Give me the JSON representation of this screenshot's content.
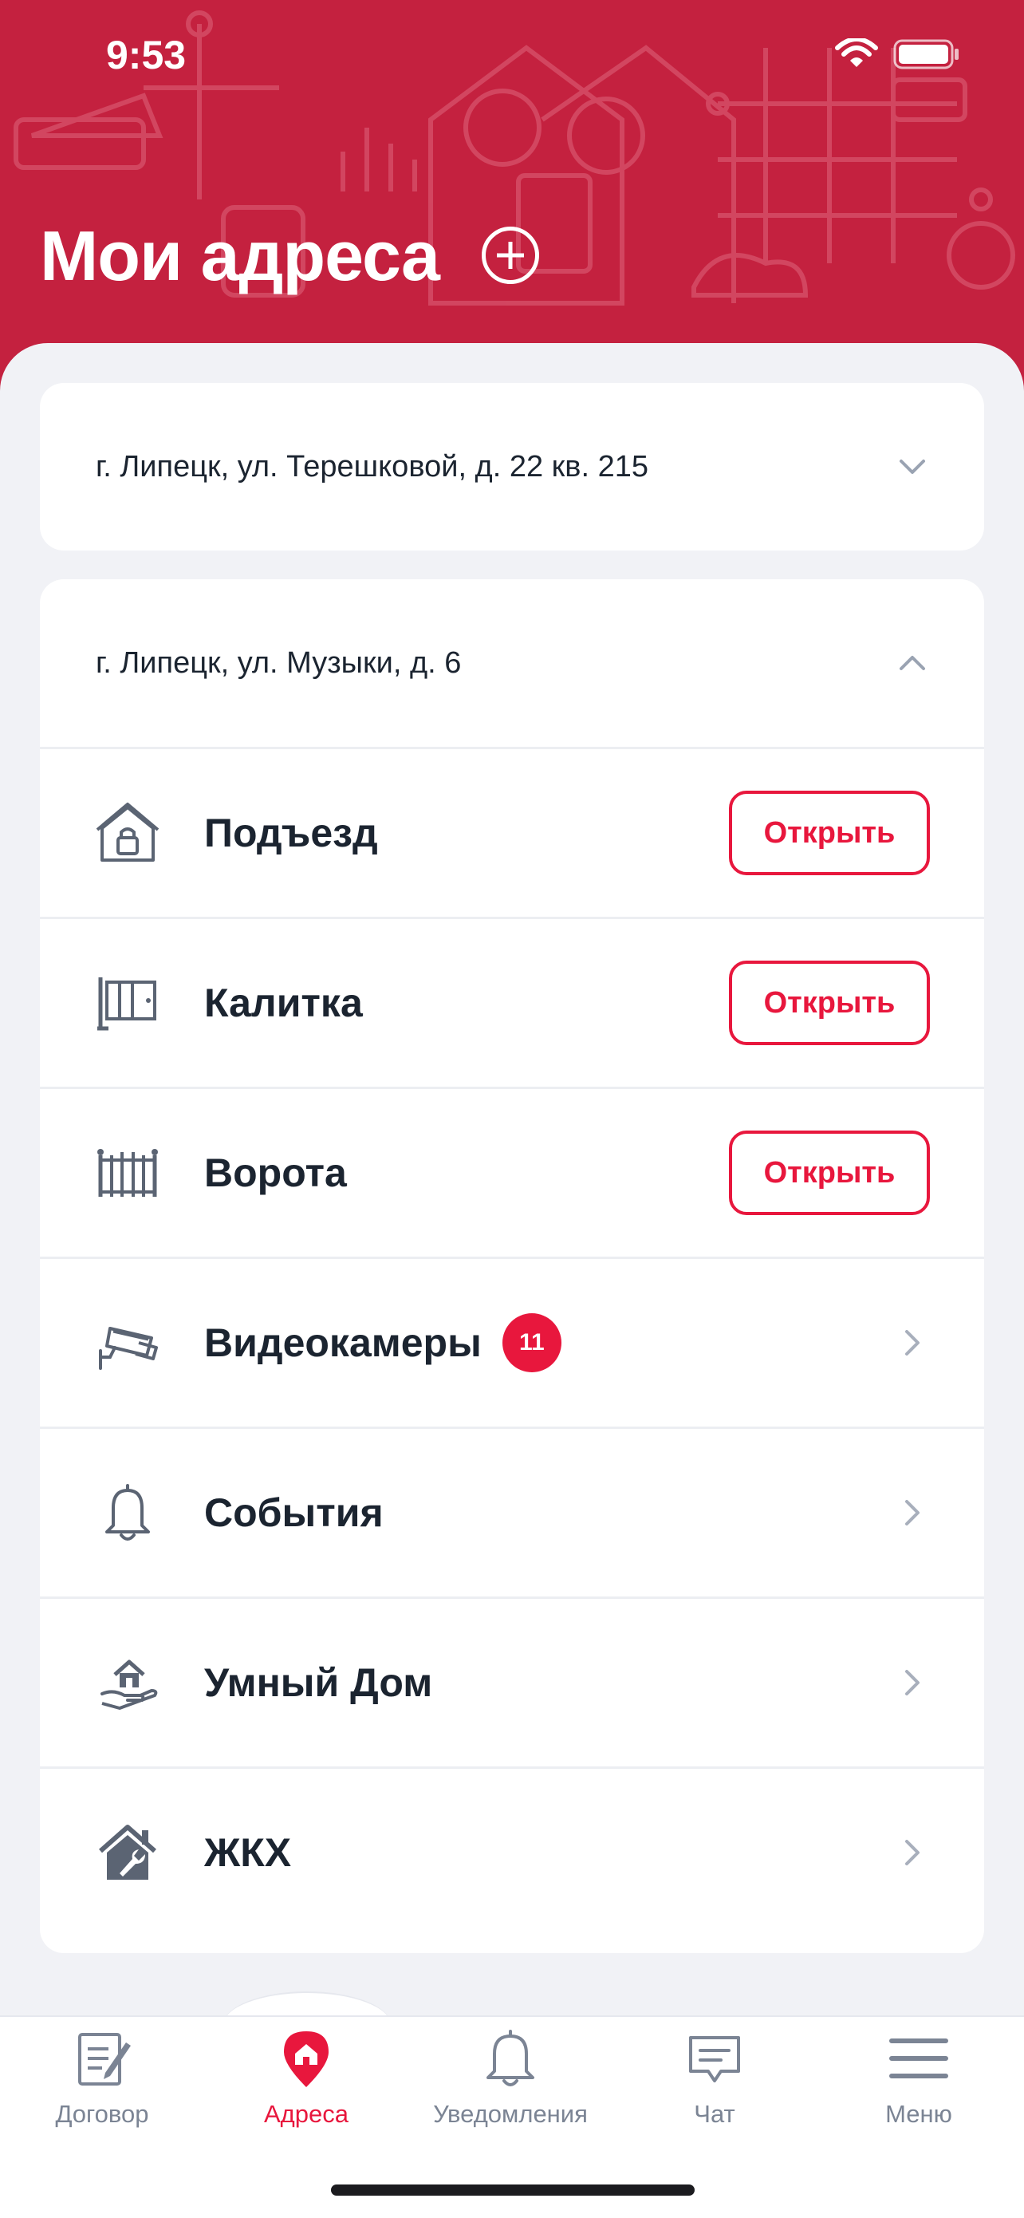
{
  "status_bar": {
    "time": "9:53"
  },
  "header": {
    "title": "Мои адреса",
    "bg_color": "#C4213F",
    "add_icon": "plus-circle-icon"
  },
  "addresses": [
    {
      "text": "г. Липецк, ул. Терешковой, д. 22 кв. 215",
      "expanded": false
    },
    {
      "text": "г. Липецк, ул. Музыки, д. 6",
      "expanded": true
    }
  ],
  "items": [
    {
      "label": "Подъезд",
      "icon": "entrance-lock-icon",
      "action": "Открыть"
    },
    {
      "label": "Калитка",
      "icon": "wicket-gate-icon",
      "action": "Открыть"
    },
    {
      "label": "Ворота",
      "icon": "gate-icon",
      "action": "Открыть"
    },
    {
      "label": "Видеокамеры",
      "icon": "camera-icon",
      "badge": "11"
    },
    {
      "label": "События",
      "icon": "bell-icon"
    },
    {
      "label": "Умный Дом",
      "icon": "smart-home-icon"
    },
    {
      "label": "ЖКХ",
      "icon": "utilities-icon"
    }
  ],
  "tabbar": [
    {
      "label": "Договор",
      "icon": "contract-icon",
      "active": false
    },
    {
      "label": "Адреса",
      "icon": "address-pin-icon",
      "active": true
    },
    {
      "label": "Уведомления",
      "icon": "bell-icon",
      "active": false
    },
    {
      "label": "Чат",
      "icon": "chat-icon",
      "active": false
    },
    {
      "label": "Меню",
      "icon": "menu-icon",
      "active": false
    }
  ],
  "colors": {
    "accent": "#E8173D",
    "header": "#C4213F",
    "text": "#1B2430",
    "muted": "#7B8494"
  }
}
